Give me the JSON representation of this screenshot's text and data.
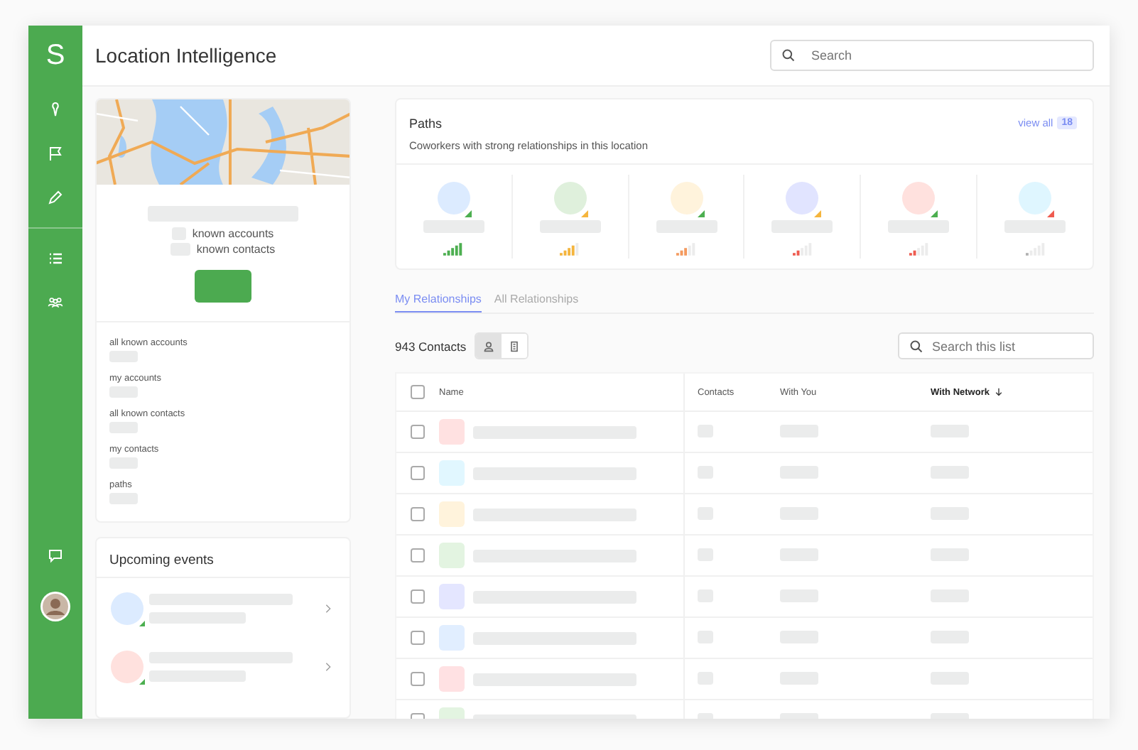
{
  "app": {
    "logo": "S",
    "title": "Location Intelligence",
    "search": {
      "placeholder": "Search"
    }
  },
  "location_card": {
    "known_accounts": "known accounts",
    "known_contacts": "known contacts"
  },
  "stats": [
    "all known accounts",
    "my accounts",
    "all known contacts",
    "my contacts",
    "paths"
  ],
  "events": {
    "title": "Upcoming events",
    "items": [
      {
        "color": "#dcebff"
      },
      {
        "color": "#ffe1de"
      }
    ]
  },
  "paths": {
    "title": "Paths",
    "subtitle": "Coworkers with strong relationships in this location",
    "view_all": "view all",
    "count": "18",
    "people": [
      {
        "color": "#dcebff",
        "status": {
          "color": "#4caf50"
        },
        "signal": {
          "level": 1,
          "color": "#4caf50"
        }
      },
      {
        "color": "#dff0dc",
        "status": {
          "color": "#f5b53d"
        },
        "signal": {
          "level": 0.8,
          "color": "#f5b53d"
        }
      },
      {
        "color": "#fff3dc",
        "status": {
          "color": "#4caf50"
        },
        "signal": {
          "level": 0.6,
          "color": "#f59a5e"
        }
      },
      {
        "color": "#e1e4ff",
        "status": {
          "color": "#f5b53d"
        },
        "signal": {
          "level": 0.4,
          "color": "#ef5b4f"
        }
      },
      {
        "color": "#ffe1de",
        "status": {
          "color": "#4caf50"
        },
        "signal": {
          "level": 0.4,
          "color": "#ef5b4f"
        }
      },
      {
        "color": "#dff6ff",
        "status": {
          "color": "#ef5b4f"
        },
        "signal": {
          "level": 0.2,
          "color": "#b0b0b0"
        }
      }
    ]
  },
  "tabs": [
    {
      "label": "My Relationships",
      "selected": true
    },
    {
      "label": "All Relationships",
      "selected": false
    }
  ],
  "contacts": {
    "count_label": "943 Contacts",
    "views": [
      {
        "kind": "person",
        "selected": true
      },
      {
        "kind": "building",
        "selected": false
      }
    ],
    "search": {
      "placeholder": "Search this list"
    }
  },
  "table": {
    "columns": [
      {
        "label": "Name",
        "sorted": false
      },
      {
        "label": "Contacts",
        "sorted": false
      },
      {
        "label": "With You",
        "sorted": false
      },
      {
        "label": "With Network",
        "sorted": true
      }
    ],
    "select_all": {
      "checked": false
    },
    "rows": [
      {
        "color": "#ffe1e1",
        "checked": false
      },
      {
        "color": "#e1f7ff",
        "checked": false
      },
      {
        "color": "#fff3dc",
        "checked": false
      },
      {
        "color": "#e3f4e1",
        "checked": false
      },
      {
        "color": "#e4e6ff",
        "checked": false
      },
      {
        "color": "#e1eeff",
        "checked": false
      },
      {
        "color": "#ffe1e3",
        "checked": false
      },
      {
        "color": "#e3f4e1",
        "checked": false
      }
    ]
  }
}
